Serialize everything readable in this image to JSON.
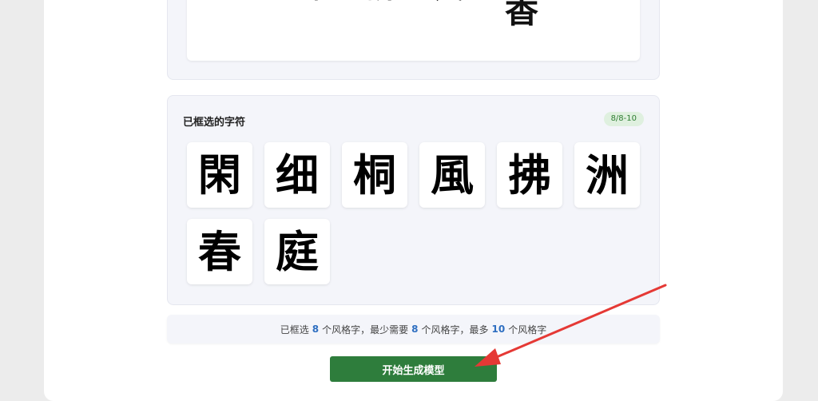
{
  "preview": {
    "glyphs": [
      "草",
      "拂",
      "风",
      "香"
    ]
  },
  "selected": {
    "title": "已框选的字符",
    "badge": "8/8-10",
    "characters": [
      "閑",
      "细",
      "桐",
      "風",
      "拂",
      "洲",
      "春",
      "庭"
    ]
  },
  "info": {
    "prefix": "已框选",
    "selected_count": "8",
    "part2": "个风格字，最少需要",
    "min_count": "8",
    "part3": "个风格字，最多",
    "max_count": "10",
    "part4": "个风格字"
  },
  "actions": {
    "start_label": "开始生成模型"
  },
  "colors": {
    "primary_green": "#2e7d3c",
    "accent_blue": "#2f6fc1",
    "arrow_red": "#e53935"
  }
}
